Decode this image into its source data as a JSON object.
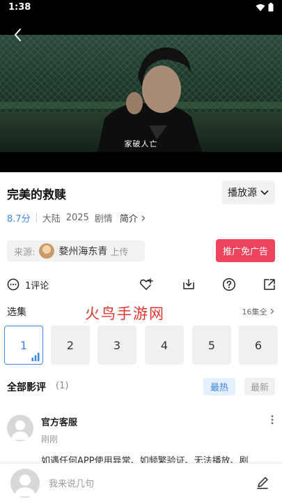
{
  "status_bar": {
    "time": "1:38"
  },
  "video": {
    "subtitle": "家破人亡"
  },
  "title": "完美的救赎",
  "source_button": {
    "label": "播放源"
  },
  "meta": {
    "score": "8.7分",
    "region": "大陆",
    "year": "2025",
    "genre": "剧情",
    "intro_label": "简介"
  },
  "uploader": {
    "prefix": "来源:",
    "name": "婺州海东青",
    "suffix": "上传"
  },
  "promo_button": {
    "label": "推广免广告"
  },
  "actions": {
    "comment_count": "1评论"
  },
  "episodes": {
    "label": "选集",
    "total": "16集全",
    "items": [
      "1",
      "2",
      "3",
      "4",
      "5",
      "6"
    ],
    "active_index": 0
  },
  "watermark": "火鸟手游网",
  "reviews": {
    "title": "全部影评",
    "count": "(1)",
    "sort_hot": "最热",
    "sort_new": "最新"
  },
  "comment": {
    "author": "官方客服",
    "time": "刚刚",
    "text": "如遇任何APP使用异常、如频繁验证、无法播放、剧"
  },
  "comment_input": {
    "placeholder": "我来说几句"
  },
  "colors": {
    "accent": "#3d86e6",
    "promo": "#f0445e",
    "watermark": "#e0352c"
  }
}
